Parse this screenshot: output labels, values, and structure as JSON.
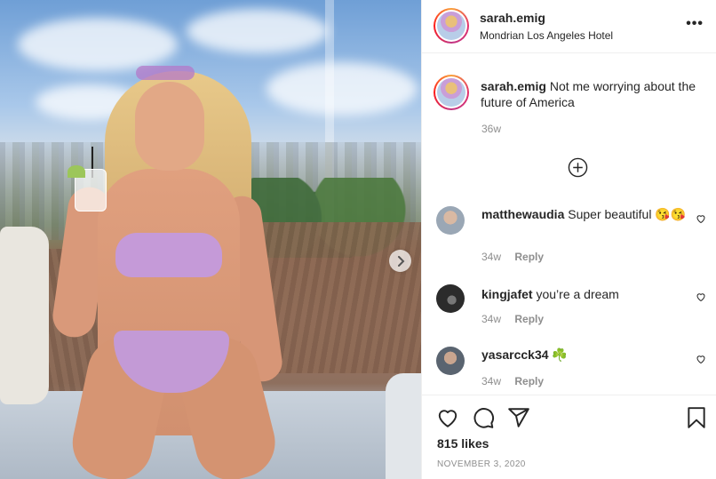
{
  "post": {
    "username": "sarah.emig",
    "location": "Mondrian Los Angeles Hotel",
    "more_label": "•••",
    "caption_username": "sarah.emig",
    "caption_text": "Not me worrying about the future of America",
    "caption_time": "36w"
  },
  "comments": [
    {
      "username": "matthewaudia",
      "text": "Super beautiful 😘😘",
      "time": "34w",
      "reply_label": "Reply",
      "avatar_color": "#9aa7b5"
    },
    {
      "username": "kingjafet",
      "text": "you’re a dream",
      "time": "34w",
      "reply_label": "Reply",
      "avatar_color": "#2b2b2b"
    },
    {
      "username": "yasarcck34",
      "text": "☘️",
      "time": "34w",
      "reply_label": "Reply",
      "avatar_color": "#5a6470"
    }
  ],
  "likes": "815 likes",
  "date": "NOVEMBER 3, 2020",
  "icons": {
    "like": "heart-icon",
    "comment": "comment-icon",
    "share": "share-icon",
    "save": "bookmark-icon",
    "load_more": "plus-circle-icon",
    "next": "chevron-right-icon"
  },
  "colors": {
    "text": "#262626",
    "muted": "#8e8e8e",
    "border": "#efefef"
  }
}
